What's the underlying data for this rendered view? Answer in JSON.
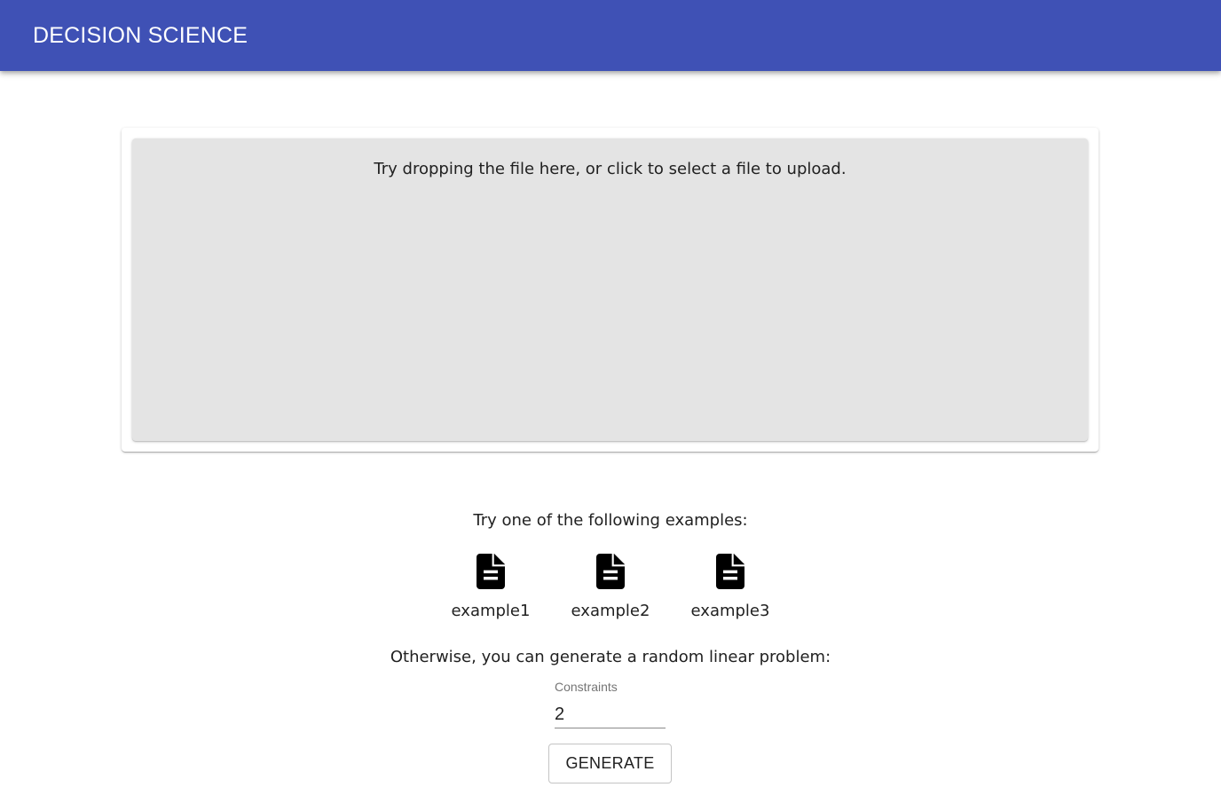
{
  "app": {
    "title": "DECISION SCIENCE"
  },
  "upload": {
    "prompt": "Try dropping the file here, or click to select a file to upload."
  },
  "examples": {
    "heading": "Try one of the following examples:",
    "items": [
      {
        "label": "example1",
        "icon": "file-document-icon"
      },
      {
        "label": "example2",
        "icon": "file-document-icon"
      },
      {
        "label": "example3",
        "icon": "file-document-icon"
      }
    ]
  },
  "generator": {
    "heading": "Otherwise, you can generate a random linear problem:",
    "constraints_label": "Constraints",
    "constraints_value": "2",
    "button_label": "GENERATE"
  },
  "colors": {
    "appbar": "#3f51b5",
    "dropzone": "#e4e4e4"
  }
}
